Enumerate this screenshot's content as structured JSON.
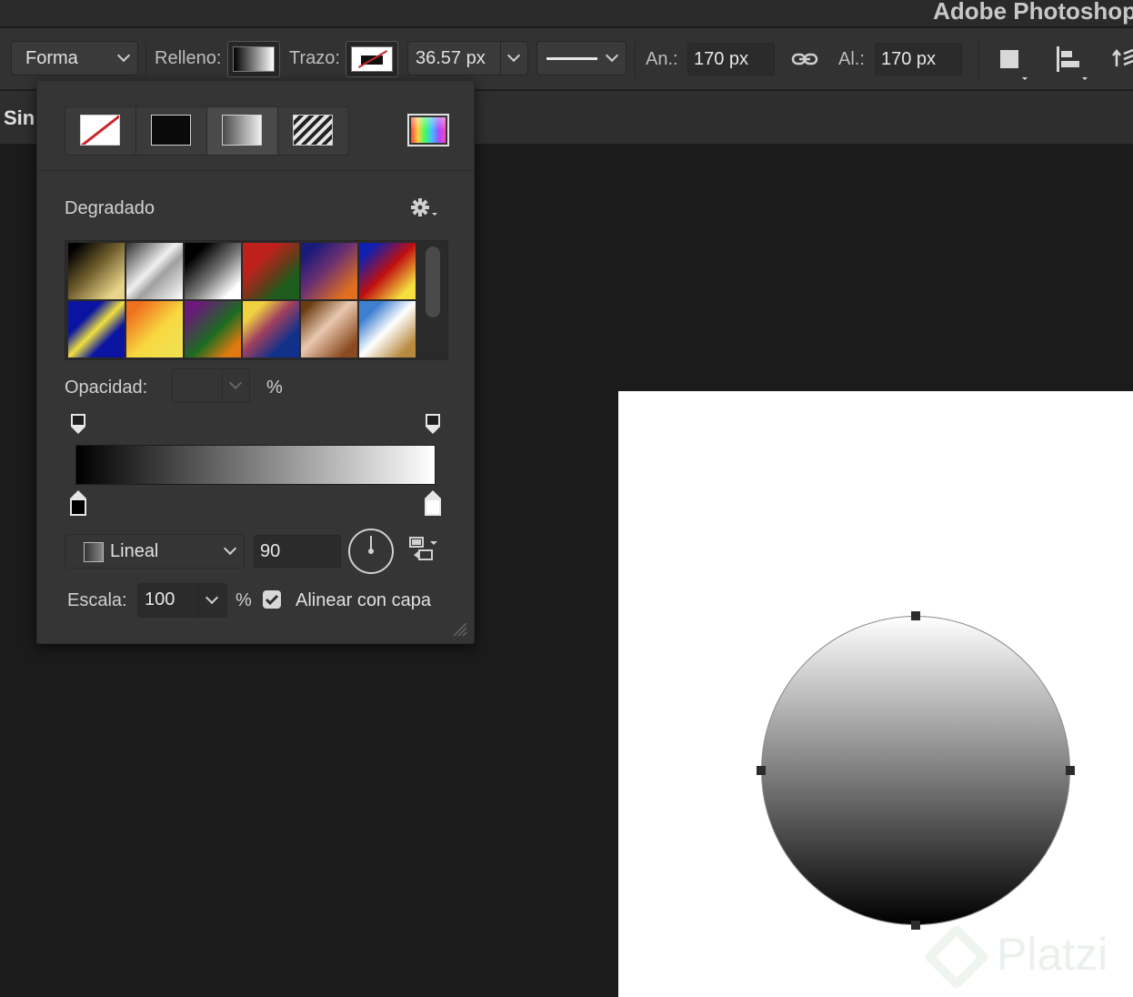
{
  "app": {
    "title": "Adobe Photoshop"
  },
  "options_bar": {
    "tool_mode": "Forma",
    "fill_label": "Relleno:",
    "stroke_label": "Trazo:",
    "stroke_width": "36.57 px",
    "width_label": "An.:",
    "width_value": "170 px",
    "height_label": "Al.:",
    "height_value": "170 px"
  },
  "document": {
    "tab_label": "Sin"
  },
  "fill_panel": {
    "section_title": "Degradado",
    "opacity_label": "Opacidad:",
    "opacity_value": "",
    "opacity_unit": "%",
    "gradient_type": "Lineal",
    "angle": "90",
    "scale_label": "Escala:",
    "scale_value": "100",
    "scale_unit": "%",
    "align_with_layer_label": "Alinear con capa",
    "align_with_layer_checked": true,
    "gradient_colors": [
      "#000000",
      "#ffffff"
    ],
    "presets": [
      "linear-gradient(135deg,#000 10%,#6b5a2a 45%,#e8d48a 85%)",
      "linear-gradient(135deg,#303030 0%,#f0f0f0 45%,#a0a0a0 60%,#ffffff 100%)",
      "linear-gradient(135deg,#000 20%,#7a7a7a 55%,#ffffff 85%)",
      "linear-gradient(135deg,#c0201c 30%,#6b3a1a 55%,#1c5c1c 75%)",
      "linear-gradient(135deg,#1a1a7a 15%,#6a3070 45%,#e07020 85%)",
      "linear-gradient(135deg,#1020b0 15%,#c01010 50%,#f5e040 85%)",
      "linear-gradient(135deg,#0a14a0 30%,#f0e040 50%,#0a14a0 70%)",
      "linear-gradient(135deg,#f07020 15%,#f8d840 55%,#f0e050 85%)",
      "linear-gradient(135deg,#6a1a7a 15%,#1c6c20 55%,#e07a10 85%)",
      "linear-gradient(135deg,#f0d040 20%,#a04060 45%,#10308a 75%)",
      "linear-gradient(135deg,#6a3a10 10%,#e8c8b0 45%,#8a4a20 85%)",
      "linear-gradient(135deg,#4080d0 20%,#ffffff 50%,#b88a40 85%)"
    ]
  },
  "colors": {
    "app_bg": "#1b1b1b",
    "panel_bg": "#353535",
    "toolbar_bg": "#323232",
    "canvas_bg": "#ffffff",
    "stroke_none_accent": "#c8262a"
  },
  "watermark": {
    "text": "Platzi"
  }
}
